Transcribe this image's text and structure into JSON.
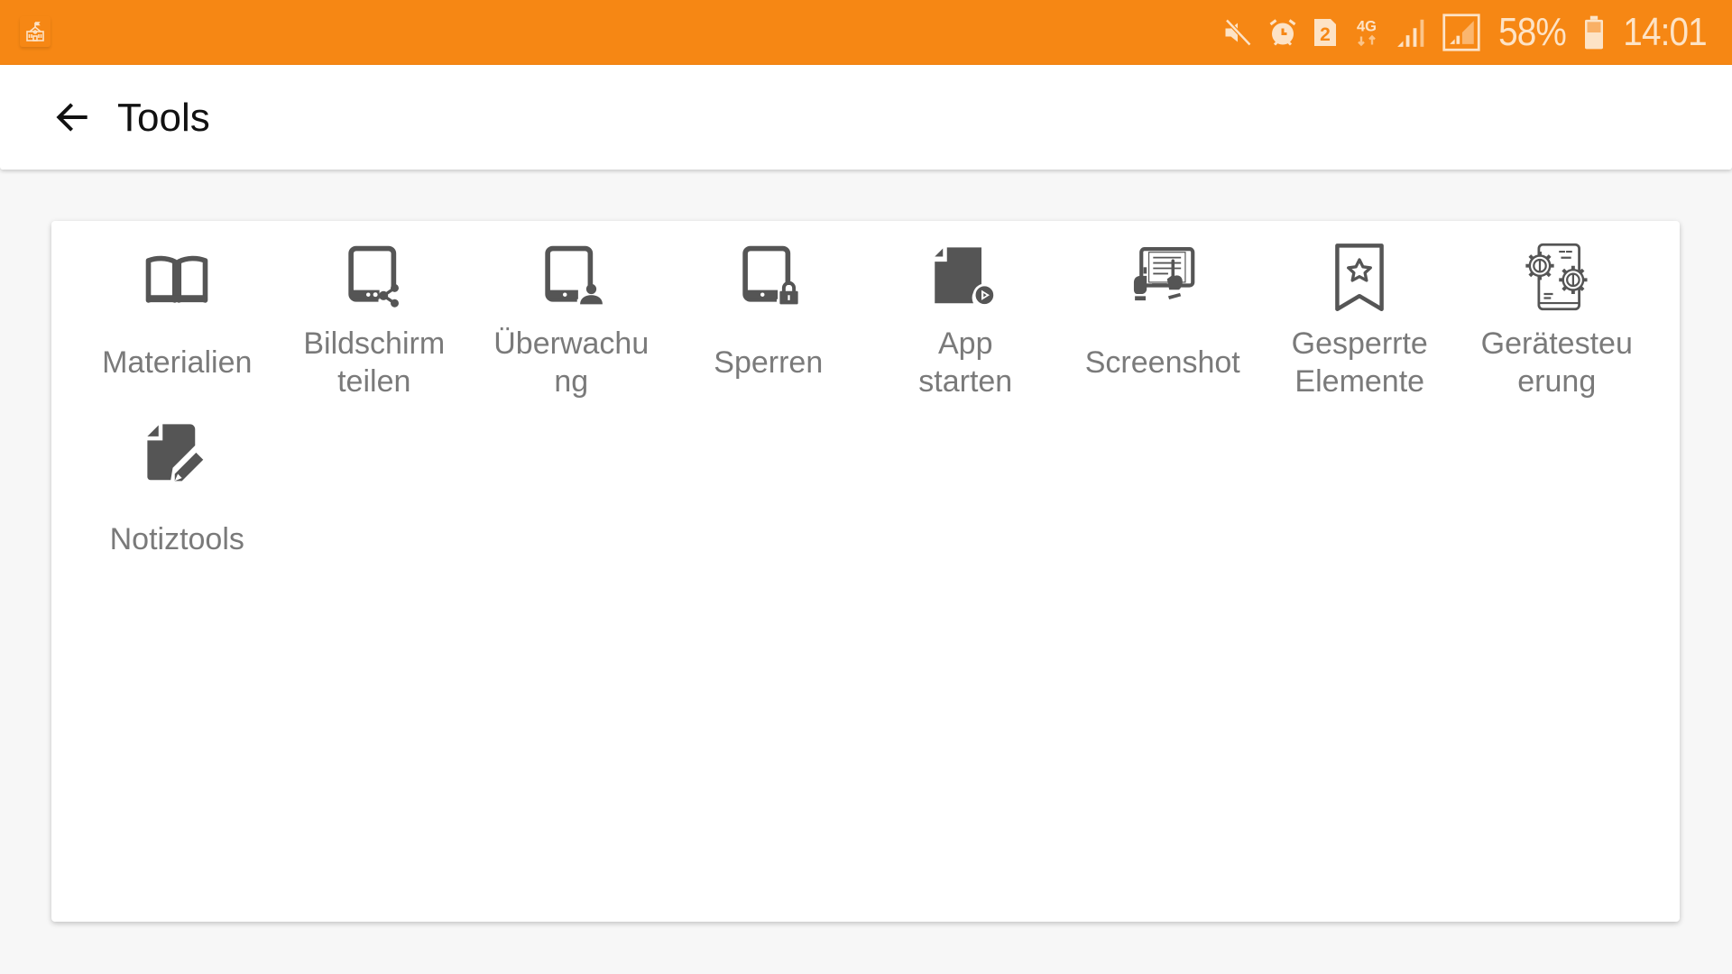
{
  "status_bar": {
    "background": "#f68714",
    "left_icon": "school-icon",
    "icons": [
      "mute-icon",
      "alarm-icon",
      "sim-2-icon",
      "4g-data-icon",
      "signal-icon",
      "signal-sim2-icon"
    ],
    "sim_label": "2",
    "network_label": "4G",
    "battery_percent": "58%",
    "battery_level": 0.58,
    "time": "14:01"
  },
  "app_bar": {
    "back_icon": "arrow-left-icon",
    "title": "Tools"
  },
  "tools": [
    {
      "id": "materialien",
      "label": "Materialien",
      "icon": "book-icon"
    },
    {
      "id": "bildschirm-teilen",
      "label": "Bildschirm\nteilen",
      "icon": "tablet-share-icon"
    },
    {
      "id": "ueberwachung",
      "label": "Überwachu\nng",
      "icon": "tablet-user-icon"
    },
    {
      "id": "sperren",
      "label": "Sperren",
      "icon": "tablet-lock-icon"
    },
    {
      "id": "app-starten",
      "label": "App\nstarten",
      "icon": "file-play-icon"
    },
    {
      "id": "screenshot",
      "label": "Screenshot",
      "icon": "tablet-hands-icon"
    },
    {
      "id": "gesperrte-elemente",
      "label": "Gesperrte\nElemente",
      "icon": "bookmark-star-icon"
    },
    {
      "id": "geraetesteuerung",
      "label": "Gerätesteu\nerung",
      "icon": "phone-gears-icon"
    },
    {
      "id": "notiztools",
      "label": "Notiztools",
      "icon": "file-pencil-icon"
    }
  ]
}
